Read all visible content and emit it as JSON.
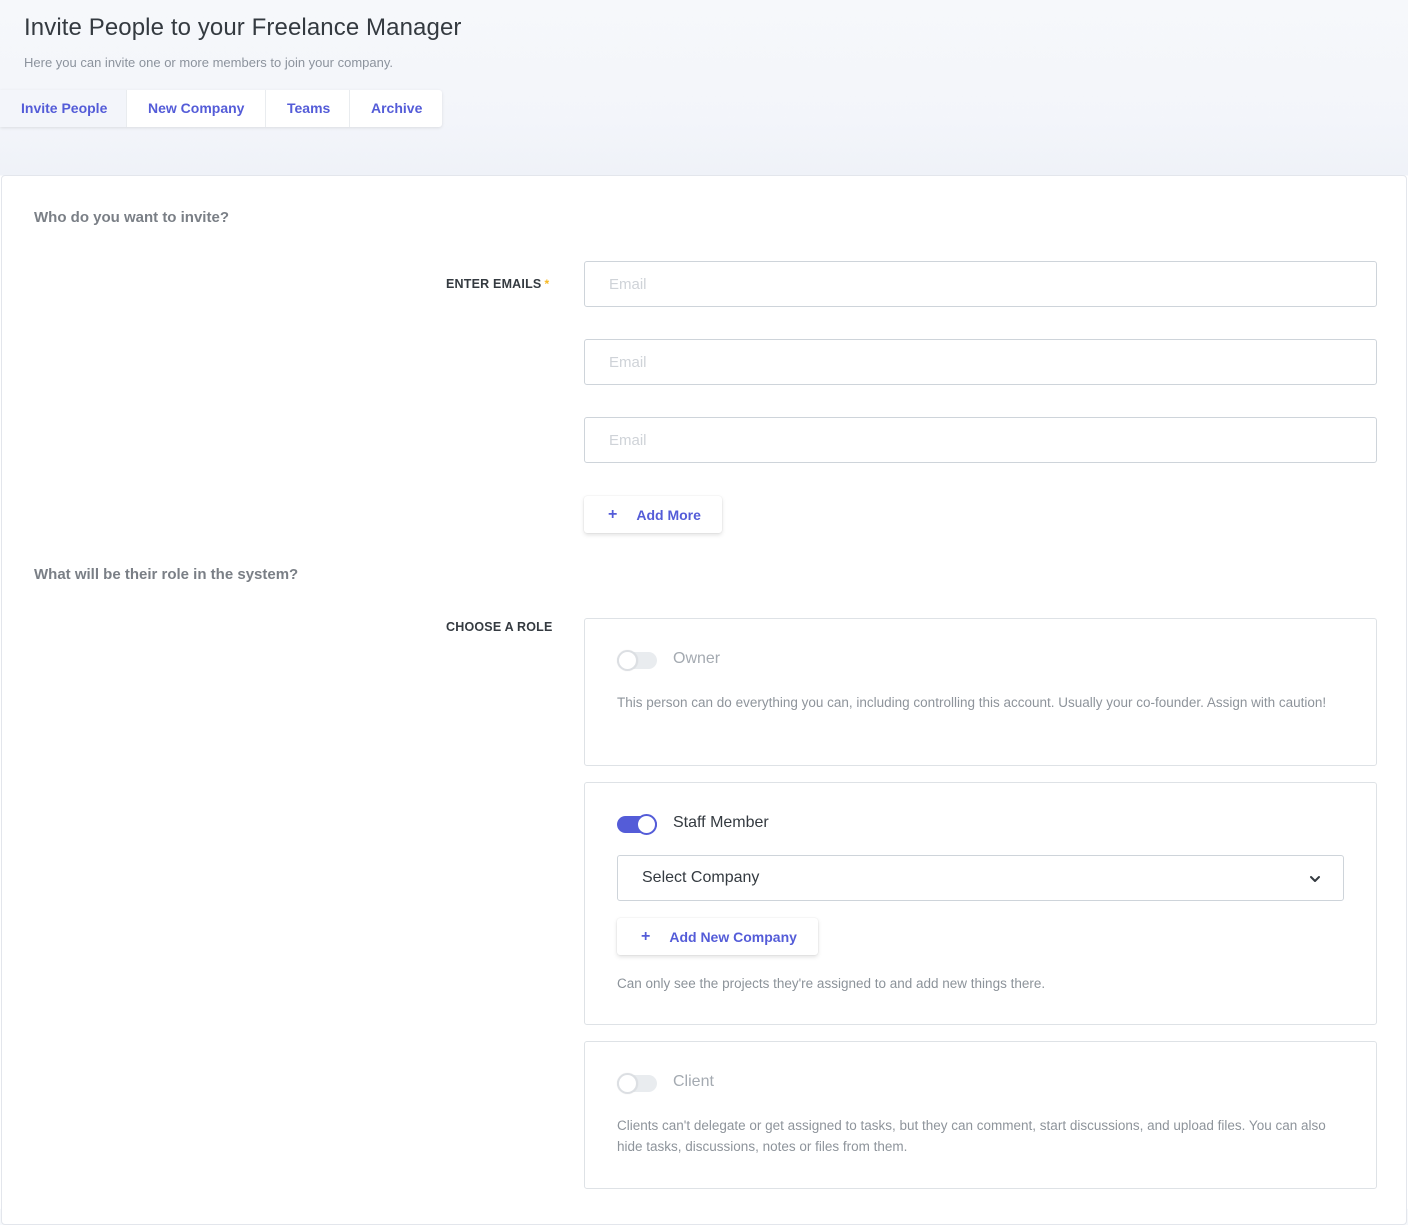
{
  "header": {
    "title": "Invite People to your Freelance Manager",
    "subtitle": "Here you can invite one or more members to join your company."
  },
  "tabs": [
    {
      "label": "Invite People",
      "active": true
    },
    {
      "label": "New Company",
      "active": false
    },
    {
      "label": "Teams",
      "active": false
    },
    {
      "label": "Archive",
      "active": false
    }
  ],
  "invite": {
    "heading": "Who do you want to invite?",
    "emails_label": "ENTER EMAILS",
    "required_mark": "*",
    "email_placeholders": [
      "Email",
      "Email",
      "Email"
    ],
    "add_more": {
      "icon": "+",
      "label": "Add More"
    }
  },
  "role": {
    "heading": "What will be their role in the system?",
    "label": "CHOOSE A ROLE",
    "options": [
      {
        "name": "Owner",
        "enabled": false,
        "description": "This person can do everything you can, including controlling this account. Usually your co-founder. Assign with caution!"
      },
      {
        "name": "Staff Member",
        "enabled": true,
        "select_company": "Select Company",
        "add_company": {
          "icon": "+",
          "label": "Add New Company"
        },
        "description": "Can only see the projects they're assigned to and add new things there."
      },
      {
        "name": "Client",
        "enabled": false,
        "description": "Clients can't delegate or get assigned to tasks, but they can comment, start discussions, and upload files. You can also hide tasks, discussions, notes or files from them."
      }
    ]
  },
  "colors": {
    "accent": "#545cd8",
    "required": "#f7b924",
    "border": "#ced4da",
    "header_bg": "#f3f5fa"
  }
}
